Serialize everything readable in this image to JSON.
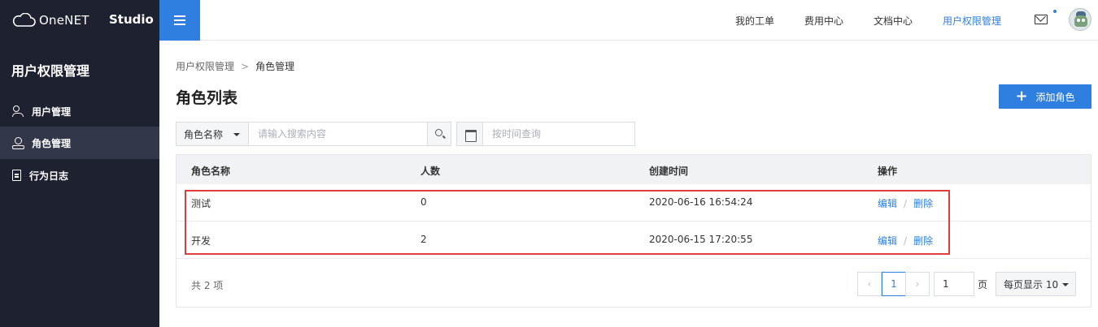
{
  "brand": {
    "name": "OneNET",
    "studio": "Studio"
  },
  "topnav": [
    {
      "label": "我的工单",
      "active": false
    },
    {
      "label": "费用中心",
      "active": false
    },
    {
      "label": "文档中心",
      "active": false
    },
    {
      "label": "用户权限管理",
      "active": true
    }
  ],
  "sidebar": {
    "title": "用户权限管理",
    "items": [
      {
        "label": "用户管理",
        "icon": "user-group-icon",
        "active": false
      },
      {
        "label": "角色管理",
        "icon": "role-icon",
        "active": true
      },
      {
        "label": "行为日志",
        "icon": "log-document-icon",
        "active": false
      }
    ]
  },
  "breadcrumb": {
    "parent": "用户权限管理",
    "separator": ">",
    "current": "角色管理"
  },
  "page_title": "角色列表",
  "add_button": {
    "icon": "+",
    "label": "添加角色"
  },
  "filter": {
    "select_value": "角色名称",
    "search_placeholder": "请输入搜索内容",
    "date_placeholder": "按时间查询"
  },
  "table": {
    "columns": [
      "角色名称",
      "人数",
      "创建时间",
      "操作"
    ],
    "rows": [
      {
        "name": "测试",
        "count": "0",
        "created": "2020-06-16 16:54:24",
        "edit": "编辑",
        "sep": "/",
        "delete": "删除"
      },
      {
        "name": "开发",
        "count": "2",
        "created": "2020-06-15 17:20:55",
        "edit": "编辑",
        "sep": "/",
        "delete": "删除"
      }
    ],
    "total": "共 2 项"
  },
  "pagination": {
    "prev": "‹",
    "current": "1",
    "next": "›",
    "page_input": "1",
    "page_unit": "页",
    "page_size": "每页显示 10"
  },
  "colors": {
    "accent": "#2f7fe0",
    "sidebar_bg": "#1e2130",
    "highlight": "#e03c3c"
  }
}
